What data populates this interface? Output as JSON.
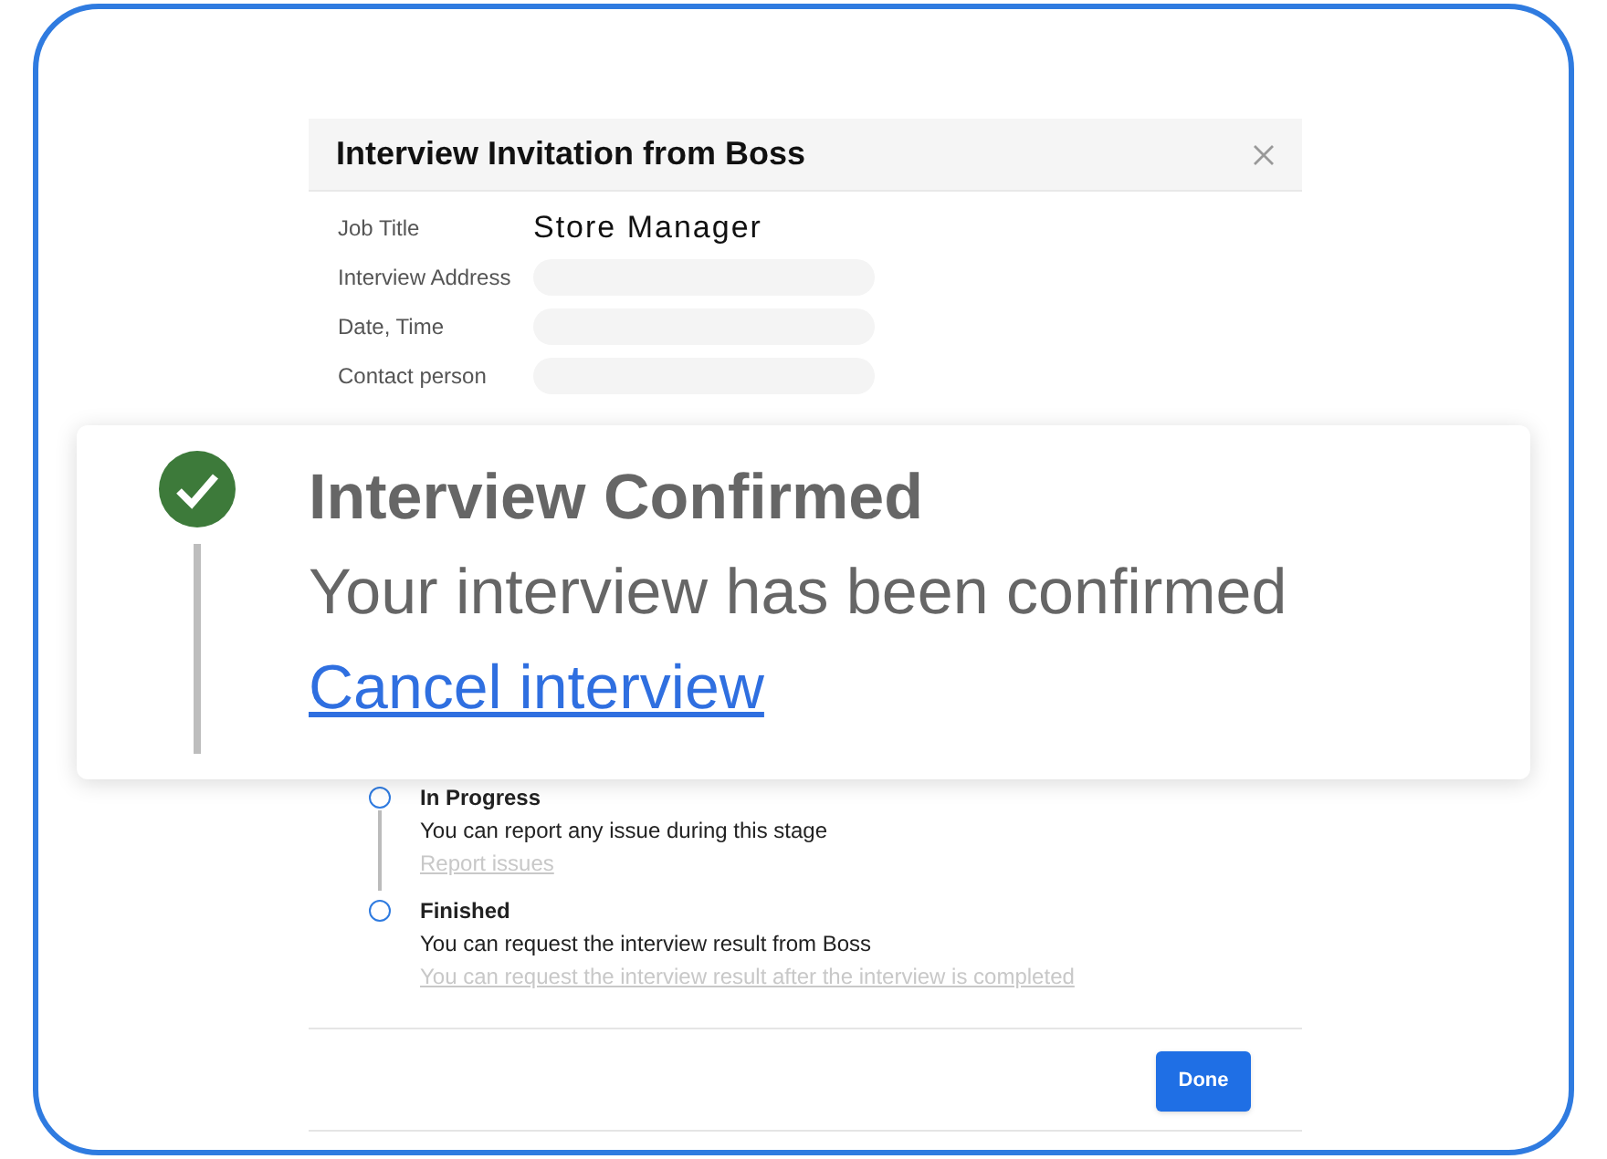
{
  "dialog": {
    "title": "Interview Invitation from Boss"
  },
  "fields": [
    {
      "label": "Job Title",
      "kind": "text",
      "value": "Store Manager"
    },
    {
      "label": "Interview Address",
      "kind": "blank"
    },
    {
      "label": "Date, Time",
      "kind": "blank"
    },
    {
      "label": "Contact person",
      "kind": "blank"
    }
  ],
  "confirmation": {
    "title": "Interview Confirmed",
    "message": "Your interview has been confirmed",
    "link": "Cancel interview"
  },
  "steps": [
    {
      "title": "In Progress",
      "description": "You can report any issue during this stage",
      "link": "Report issues"
    },
    {
      "title": "Finished",
      "description": "You can request the interview result from Boss",
      "link": "You can request the interview result after the interview is completed"
    }
  ],
  "buttons": [
    "Done"
  ]
}
